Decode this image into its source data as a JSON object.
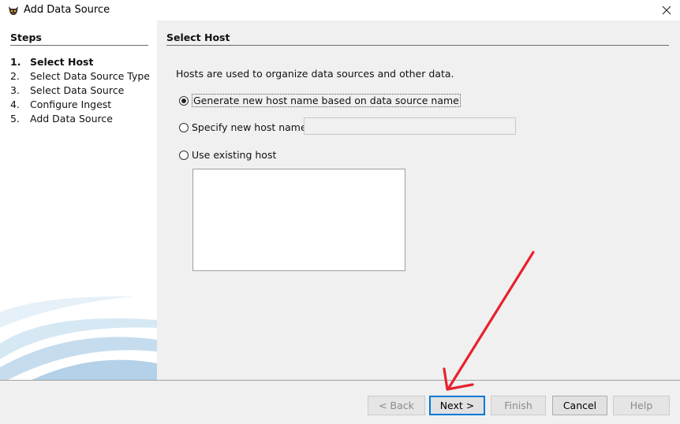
{
  "window": {
    "title": "Add Data Source"
  },
  "steps": {
    "header": "Steps",
    "items": [
      {
        "num": "1.",
        "label": "Select Host"
      },
      {
        "num": "2.",
        "label": "Select Data Source Type"
      },
      {
        "num": "3.",
        "label": "Select Data Source"
      },
      {
        "num": "4.",
        "label": "Configure Ingest"
      },
      {
        "num": "5.",
        "label": "Add Data Source"
      }
    ],
    "current_index": 0
  },
  "content": {
    "header": "Select Host",
    "description": "Hosts are used to organize data sources and other data.",
    "options": {
      "generate": "Generate new host name based on data source name",
      "specify": "Specify new host name",
      "existing": "Use existing host"
    },
    "selected_option": "generate",
    "host_name_value": ""
  },
  "buttons": {
    "back": "< Back",
    "next": "Next >",
    "finish": "Finish",
    "cancel": "Cancel",
    "help": "Help"
  },
  "colors": {
    "annotation_arrow": "#e8212e",
    "default_button_border": "#0078d7"
  },
  "icons": {
    "app": "autopsy-dog-icon",
    "close": "close-x-icon"
  }
}
